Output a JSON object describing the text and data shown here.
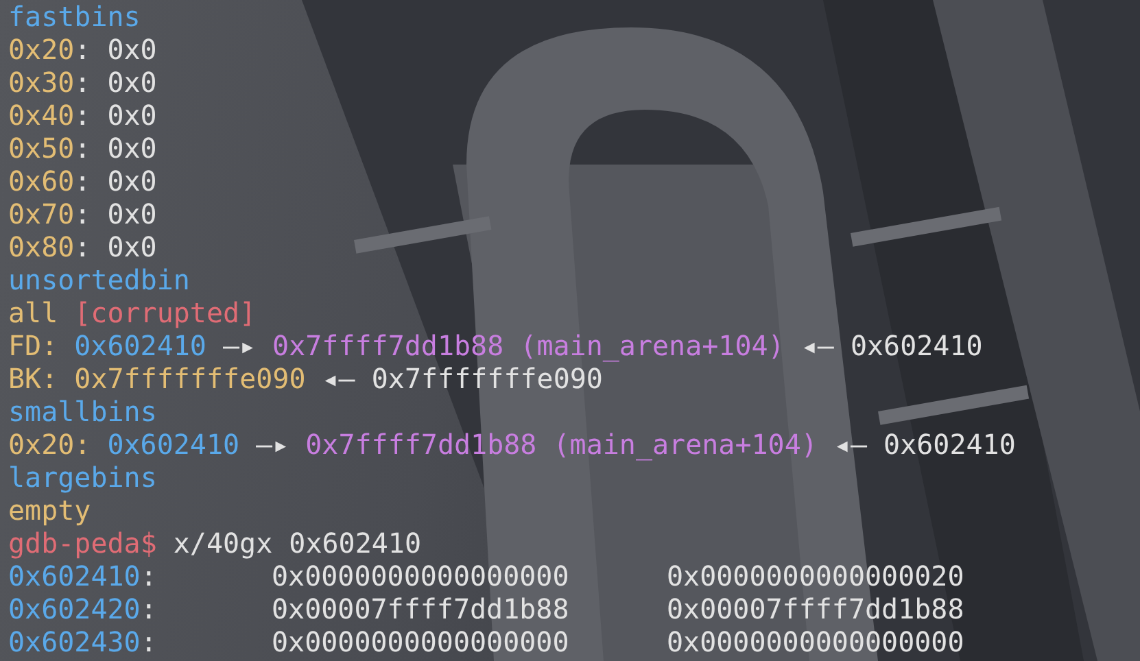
{
  "lines": [
    {
      "kind": "text",
      "segments": [
        {
          "kind": "section",
          "text": "fastbins"
        }
      ]
    },
    {
      "kind": "text",
      "segments": [
        {
          "kind": "address",
          "text": "0x20",
          "suffix": ":"
        },
        {
          "kind": "plain",
          "text": "0x0"
        }
      ]
    },
    {
      "kind": "text",
      "segments": [
        {
          "kind": "address",
          "text": "0x30",
          "suffix": ":"
        },
        {
          "kind": "plain",
          "text": "0x0"
        }
      ]
    },
    {
      "kind": "text",
      "segments": [
        {
          "kind": "address",
          "text": "0x40",
          "suffix": ":"
        },
        {
          "kind": "plain",
          "text": "0x0"
        }
      ]
    },
    {
      "kind": "text",
      "segments": [
        {
          "kind": "address",
          "text": "0x50",
          "suffix": ":"
        },
        {
          "kind": "plain",
          "text": "0x0"
        }
      ]
    },
    {
      "kind": "text",
      "segments": [
        {
          "kind": "address",
          "text": "0x60",
          "suffix": ":"
        },
        {
          "kind": "plain",
          "text": "0x0"
        }
      ]
    },
    {
      "kind": "text",
      "segments": [
        {
          "kind": "address",
          "text": "0x70",
          "suffix": ":"
        },
        {
          "kind": "plain",
          "text": "0x0"
        }
      ]
    },
    {
      "kind": "text",
      "segments": [
        {
          "kind": "address",
          "text": "0x80",
          "suffix": ":"
        },
        {
          "kind": "plain",
          "text": "0x0"
        }
      ]
    },
    {
      "kind": "text",
      "segments": [
        {
          "kind": "section",
          "text": "unsortedbin"
        }
      ]
    },
    {
      "kind": "text",
      "segments": [
        {
          "kind": "address",
          "text": "all"
        },
        {
          "kind": "error",
          "text": "[corrupted]"
        }
      ]
    },
    {
      "kind": "text",
      "segments": [
        {
          "kind": "address",
          "text": "FD:"
        },
        {
          "kind": "section",
          "text": "0x602410"
        },
        {
          "kind": "plain",
          "text": "—▸"
        },
        {
          "kind": "symbol",
          "text": "0x7ffff7dd1b88 (main_arena+104)"
        },
        {
          "kind": "plain",
          "text": "◂— 0x602410"
        }
      ]
    },
    {
      "kind": "text",
      "segments": [
        {
          "kind": "address",
          "text": "BK: 0x7fffffffe090"
        },
        {
          "kind": "plain",
          "text": "◂— 0x7fffffffe090"
        }
      ]
    },
    {
      "kind": "text",
      "segments": [
        {
          "kind": "section",
          "text": "smallbins"
        }
      ]
    },
    {
      "kind": "text",
      "segments": [
        {
          "kind": "address",
          "text": "0x20:"
        },
        {
          "kind": "section",
          "text": "0x602410"
        },
        {
          "kind": "plain",
          "text": "—▸"
        },
        {
          "kind": "symbol",
          "text": "0x7ffff7dd1b88 (main_arena+104)"
        },
        {
          "kind": "plain",
          "text": "◂— 0x602410"
        }
      ]
    },
    {
      "kind": "text",
      "segments": [
        {
          "kind": "section",
          "text": "largebins"
        }
      ]
    },
    {
      "kind": "text",
      "segments": [
        {
          "kind": "address",
          "text": "empty"
        }
      ]
    },
    {
      "kind": "text",
      "segments": [
        {
          "kind": "error",
          "text": "gdb-peda$"
        },
        {
          "kind": "plain",
          "text": "x/40gx 0x602410"
        }
      ]
    },
    {
      "kind": "dump",
      "address": "0x602410",
      "separator": ":",
      "values": [
        "0x0000000000000000",
        "0x0000000000000020"
      ]
    },
    {
      "kind": "dump",
      "address": "0x602420",
      "separator": ":",
      "values": [
        "0x00007ffff7dd1b88",
        "0x00007ffff7dd1b88"
      ]
    },
    {
      "kind": "dump",
      "address": "0x602430",
      "separator": ":",
      "values": [
        "0x0000000000000000",
        "0x0000000000000000"
      ]
    }
  ]
}
